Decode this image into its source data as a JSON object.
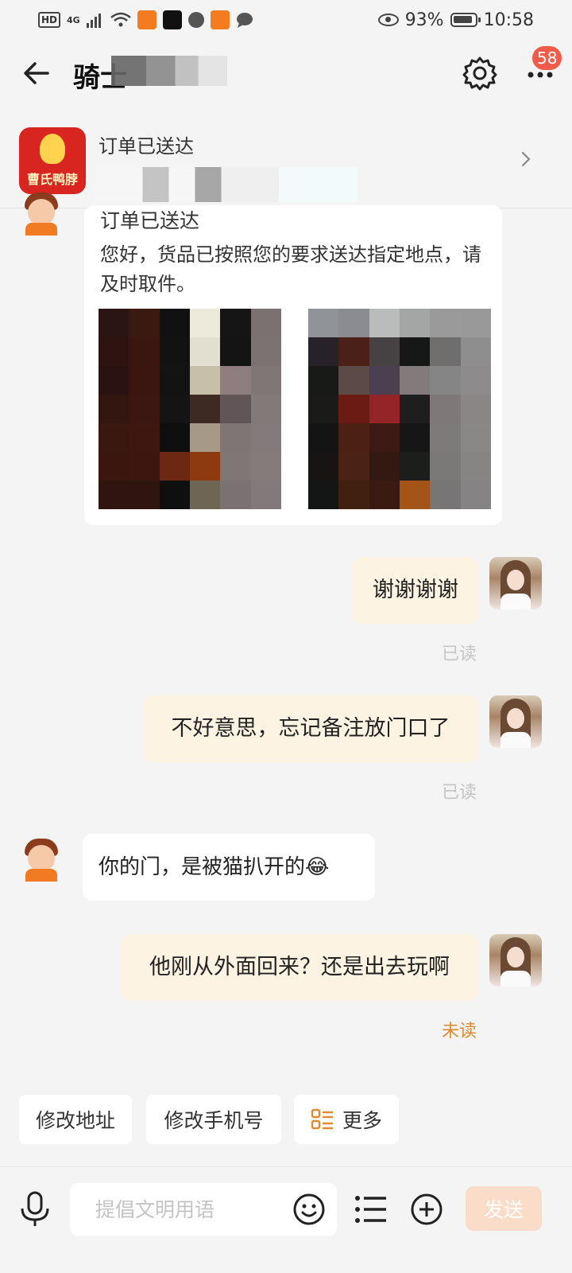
{
  "status_bar": {
    "network": "HD",
    "signal_label": "4G",
    "battery_percent": "93%",
    "time": "10:58"
  },
  "header": {
    "title": "骑士",
    "notification_count": "58"
  },
  "order_card": {
    "status": "订单已送达"
  },
  "messages": {
    "delivery": {
      "title": "订单已送达",
      "body": "您好，货品已按照您的要求送达指定地点，请及时取件。"
    },
    "out1": {
      "text": "谢谢谢谢",
      "status": "已读"
    },
    "out2": {
      "text": "不好意思，忘记备注放门口了",
      "status": "已读"
    },
    "in1": {
      "text": "你的门，是被猫扒开的😂"
    },
    "out3": {
      "text": "他刚从外面回来？还是出去玩啊",
      "status": "未读"
    }
  },
  "quick_replies": {
    "change_address": "修改地址",
    "change_phone": "修改手机号",
    "more": "更多"
  },
  "input_bar": {
    "placeholder": "提倡文明用语",
    "send_label": "发送"
  },
  "colors": {
    "accent": "#e08a2f",
    "badge": "#f25a4a",
    "outgoing_bubble": "#fdf3e3",
    "send_button": "#fadcc8"
  }
}
